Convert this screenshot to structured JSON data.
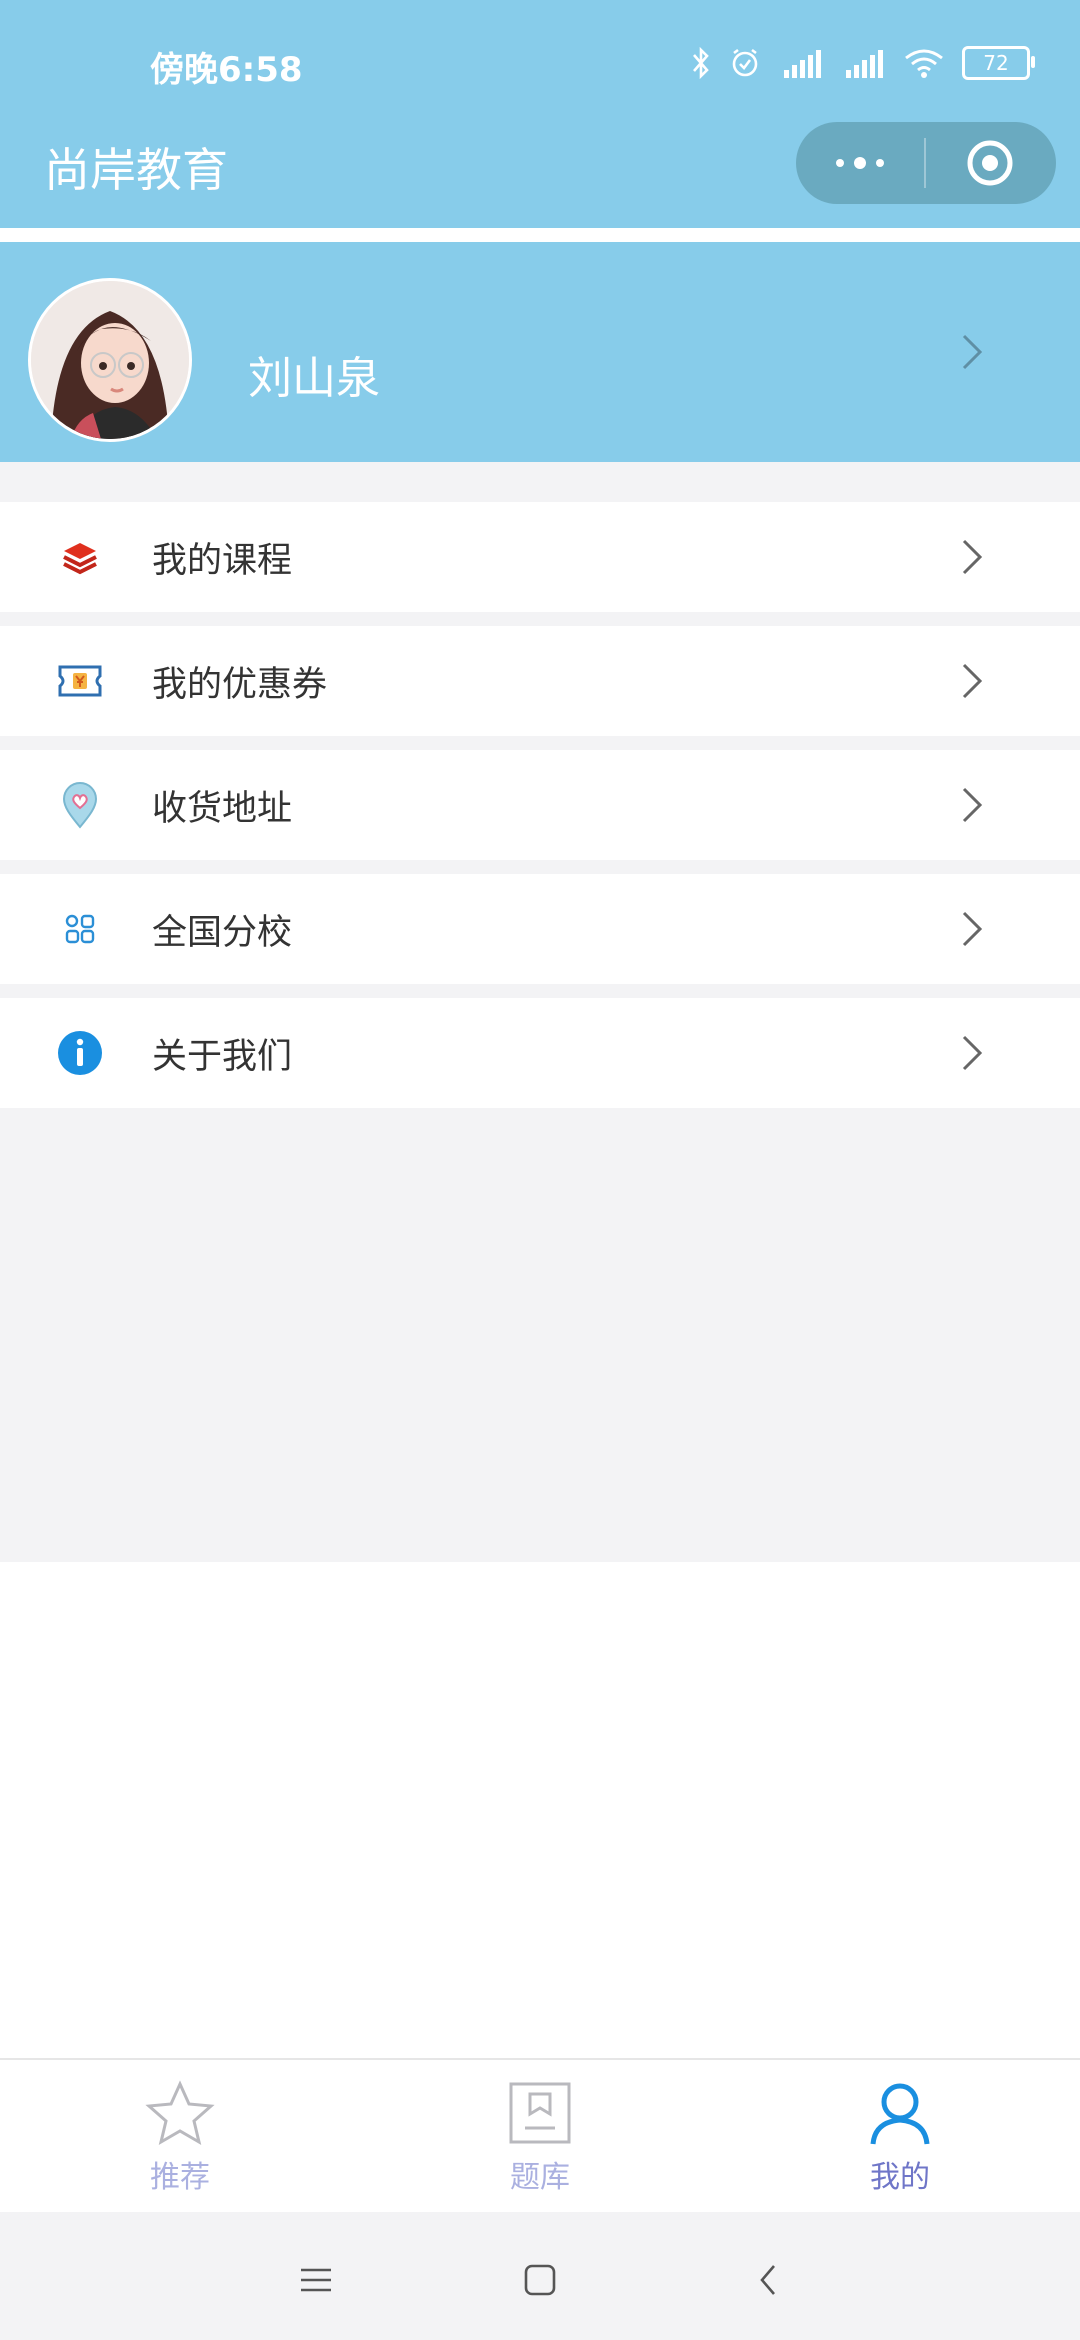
{
  "status": {
    "time": "傍晚6:58",
    "battery": "72"
  },
  "app": {
    "title": "尚岸教育"
  },
  "profile": {
    "name": "刘山泉"
  },
  "menu": {
    "items": [
      {
        "label": "我的课程",
        "icon": "layers-icon"
      },
      {
        "label": "我的优惠券",
        "icon": "coupon-icon"
      },
      {
        "label": "收货地址",
        "icon": "location-pin-icon"
      },
      {
        "label": "全国分校",
        "icon": "grid-icon"
      },
      {
        "label": "关于我们",
        "icon": "info-icon"
      }
    ]
  },
  "tabs": [
    {
      "label": "推荐",
      "icon": "star-icon",
      "active": false
    },
    {
      "label": "题库",
      "icon": "bookmark-icon",
      "active": false
    },
    {
      "label": "我的",
      "icon": "user-icon",
      "active": true
    }
  ],
  "colors": {
    "header": "#87CCEA",
    "active_tab": "#6F76C8",
    "inactive_tab": "#AAB0E0",
    "background": "#F3F3F5"
  }
}
